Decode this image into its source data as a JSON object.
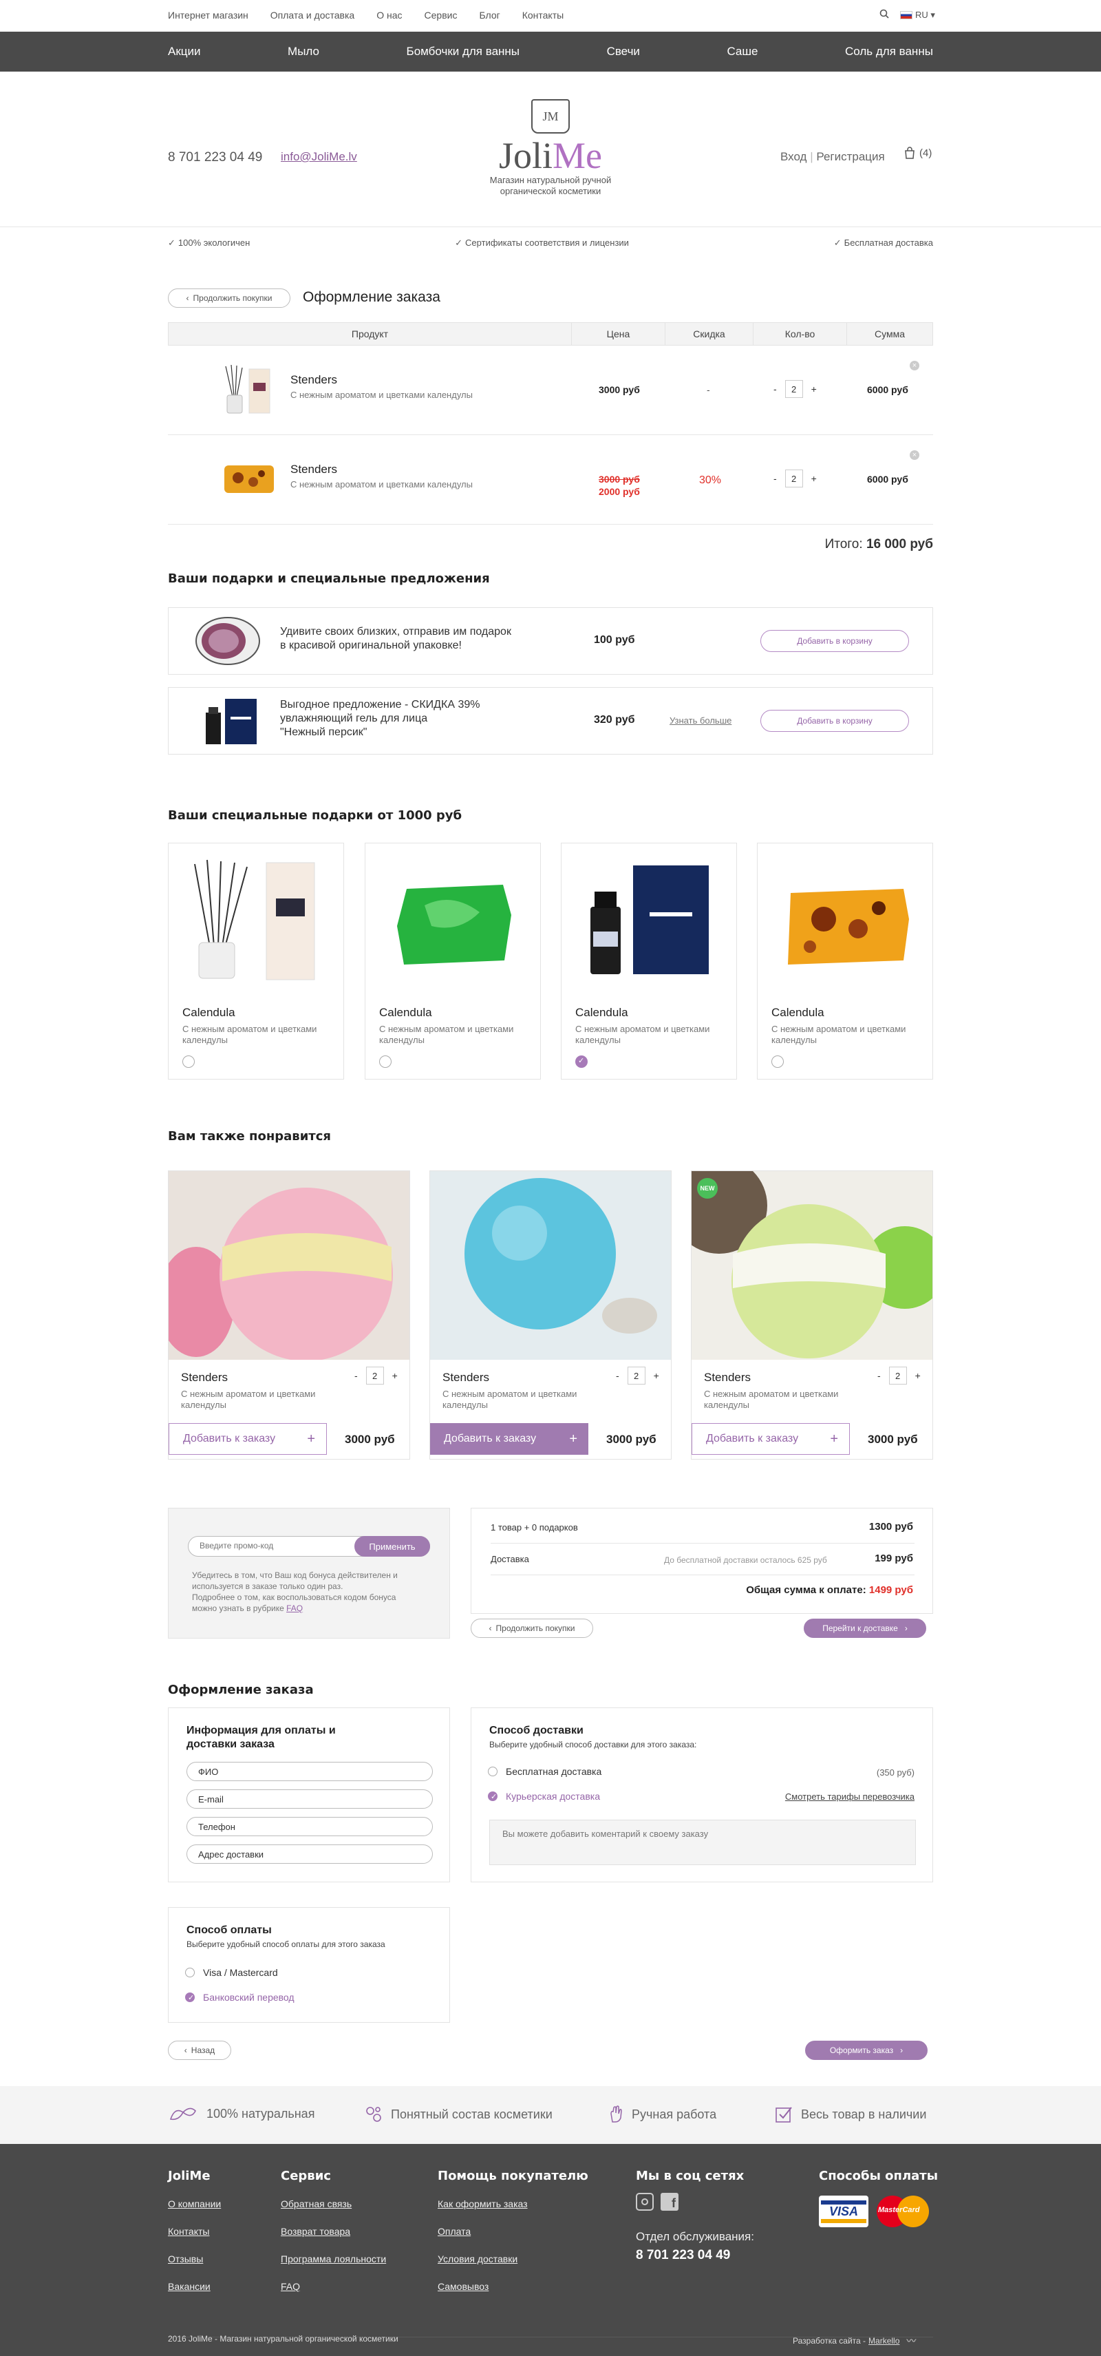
{
  "topbar": {
    "links": [
      "Интернет магазин",
      "Оплата и доставка",
      "О нас",
      "Сервис",
      "Блог",
      "Контакты"
    ],
    "lang": "RU"
  },
  "nav": [
    "Акции",
    "Мыло",
    "Бомбочки для ванны",
    "Свечи",
    "Саше",
    "Соль для ванны"
  ],
  "header": {
    "phone": "8 701 223 04 49",
    "email": "info@JoliMe.lv",
    "logo_mono": "JM",
    "logo_a": "Joli",
    "logo_b": "Me",
    "tagline1": "Магазин натуральной ручной",
    "tagline2": "органической косметики",
    "login": "Вход",
    "register": "Регистрация",
    "cart_count": "(4)"
  },
  "features": [
    "100% экологичен",
    "Сертификаты соответствия и лицензии",
    "Бесплатная доставка"
  ],
  "checkout": {
    "back": "Продолжить покупки",
    "title": "Оформление заказа"
  },
  "table": {
    "headers": [
      "Продукт",
      "Цена",
      "Скидка",
      "Кол-во",
      "Сумма"
    ],
    "rows": [
      {
        "name": "Stenders",
        "desc": "С нежным ароматом и цветками календулы",
        "price": "3000 руб",
        "discount": "-",
        "qty": "2",
        "sum": "6000 руб"
      },
      {
        "name": "Stenders",
        "desc": "С нежным ароматом и цветками календулы",
        "old_price": "3000 руб",
        "price": "2000 руб",
        "discount": "30%",
        "qty": "2",
        "sum": "6000 руб"
      }
    ],
    "total_label": "Итого:",
    "total": "16 000 руб"
  },
  "gifts": {
    "title": "Ваши подарки и специальные предложения",
    "items": [
      {
        "text1": "Удивите своих близких, отправив им подарок",
        "text2": "в красивой оригинальной упаковке!",
        "price": "100 руб",
        "button": "Добавить в корзину"
      },
      {
        "text1": "Выгодное предложение - СКИДКА 39%",
        "text2": "увлажняющий гель для лица",
        "text3": "\"Нежный персик\"",
        "price": "320 руб",
        "more": "Узнать больше",
        "button": "Добавить в корзину"
      }
    ]
  },
  "special": {
    "title": "Ваши специальные подарки от 1000 руб",
    "items": [
      {
        "name": "Calendula",
        "desc1": "С нежным ароматом и цветками",
        "desc2": "календулы",
        "selected": false
      },
      {
        "name": "Calendula",
        "desc1": "С нежным ароматом и цветками",
        "desc2": "календулы",
        "selected": false
      },
      {
        "name": "Calendula",
        "desc1": "С нежным ароматом и цветками",
        "desc2": "календулы",
        "selected": true
      },
      {
        "name": "Calendula",
        "desc1": "С нежным ароматом и цветками",
        "desc2": "календулы",
        "selected": false
      }
    ]
  },
  "also": {
    "title": "Вам также понравится",
    "items": [
      {
        "name": "Stenders",
        "desc1": "С нежным ароматом и цветками",
        "desc2": "календулы",
        "qty": "2",
        "button": "Добавить к заказу",
        "price": "3000 руб"
      },
      {
        "name": "Stenders",
        "desc1": "С нежным ароматом и цветками",
        "desc2": "календулы",
        "qty": "2",
        "button": "Добавить к заказу",
        "price": "3000 руб"
      },
      {
        "name": "Stenders",
        "desc1": "С нежным ароматом и цветками",
        "desc2": "календулы",
        "qty": "2",
        "button": "Добавить к заказу",
        "price": "3000 руб",
        "badge": "NEW"
      }
    ]
  },
  "promo": {
    "placeholder": "Введите промо-код",
    "apply": "Применить",
    "note1": "Убедитесь в том, что Ваш код бонуса действителен и",
    "note2": "используется в заказе только один раз.",
    "note3": "Подробнее о том, как воспользоваться кодом бонуса",
    "note4": "можно узнать в рубрике",
    "faq": "FAQ"
  },
  "summary": {
    "items_label": "1 товар + 0 подарков",
    "items_sum": "1300 руб",
    "delivery_label": "Доставка",
    "delivery_note": "До бесплатной доставки осталось 625 руб",
    "delivery_sum": "199 руб",
    "total_label": "Общая сумма к оплате:",
    "total": "1499 руб",
    "continue": "Продолжить покупки",
    "next": "Перейти к доставке"
  },
  "order": {
    "title": "Оформление заказа",
    "info_title1": "Информация для оплаты и",
    "info_title2": "доставки заказа",
    "fields": [
      "ФИО",
      "E-mail",
      "Телефон",
      "Адрес доставки"
    ],
    "delivery_title": "Способ доставки",
    "delivery_sub": "Выберите удобный способ доставки для этого заказа:",
    "free": "Бесплатная доставка",
    "free_price": "(350 руб)",
    "courier": "Курьерская доставка",
    "rates": "Смотреть тарифы перевозчика",
    "comment": "Вы можете добавить коментарий к своему заказу",
    "pay_title": "Способ оплаты",
    "pay_sub": "Выберите удобный способ оплаты для этого заказа",
    "visa": "Visa / Mastercard",
    "bank": "Банковский перевод",
    "back": "Назад",
    "submit": "Оформить заказ"
  },
  "benefits": [
    "100% натуральная",
    "Понятный состав косметики",
    "Ручная работа",
    "Весь товар в наличии"
  ],
  "footer": {
    "cols": [
      {
        "title": "JoliMe",
        "links": [
          "О компании",
          "Контакты",
          "Отзывы",
          "Вакансии"
        ]
      },
      {
        "title": "Сервис",
        "links": [
          "Обратная связь",
          "Возврат товара",
          "Программа лояльности",
          "FAQ"
        ]
      },
      {
        "title": "Помощь покупателю",
        "links": [
          "Как оформить заказ",
          "Оплата",
          "Условия доставки",
          "Самовывоз"
        ]
      }
    ],
    "social_title": "Мы в соц сетях",
    "service_label": "Отдел обслуживания:",
    "service_phone": "8 701 223 04 49",
    "pay_title": "Способы оплаты",
    "visa": "VISA",
    "mastercard": "MasterCard",
    "copyright": "2016 JoliMe - Магазин натуральной органической косметики",
    "dev_label": "Разработка сайта -",
    "dev": "Markello"
  },
  "colors": {
    "accent": "#a07bb0",
    "dark": "#4a4a4a",
    "sale": "#e0302a"
  }
}
